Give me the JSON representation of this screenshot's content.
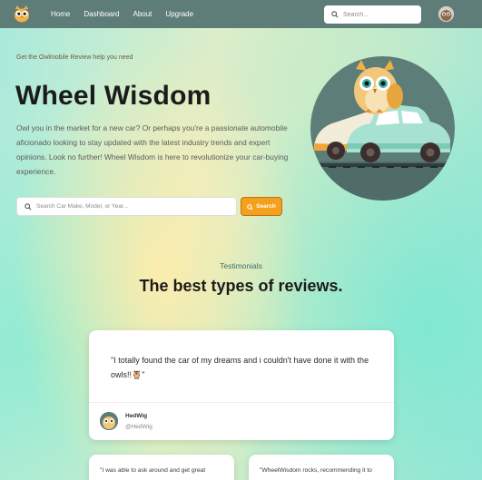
{
  "nav": {
    "links": [
      "Home",
      "Dashboard",
      "About",
      "Upgrade"
    ],
    "search_placeholder": "Search..."
  },
  "hero": {
    "kicker": "Get the Owlmobile Review help you need",
    "title": "Wheel Wisdom",
    "body": "Owl you in the market for a new car? Or perhaps you're a passionate automobile aficionado looking to stay updated with the latest industry trends and expert opinions. Look no further! Wheel Wisdom is here to revolutionize your car-buying experience.",
    "search_placeholder": "Search Car Make, Model, or Year...",
    "search_button": "Search"
  },
  "testimonials": {
    "kicker": "Testimonials",
    "title": "The best types of reviews.",
    "featured": {
      "quote": "\"I totally found the car of my dreams and i couldn't have done it with the owls!!🦉\"",
      "name": "HedWig",
      "handle": "@HedWig"
    },
    "more": [
      "\"I was able to ask around and get great",
      "\"WheelWisdom rocks, recommending it to"
    ]
  },
  "colors": {
    "navbar": "#5e7d79",
    "accent_button": "#f5a01c",
    "illustration_bg": "#5d7d78"
  }
}
